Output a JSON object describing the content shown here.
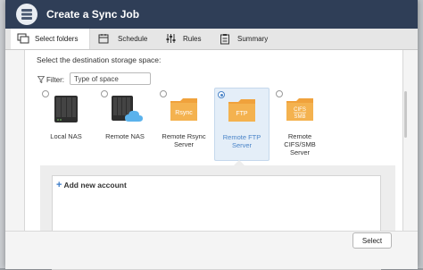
{
  "dialog": {
    "title": "Create a Sync Job"
  },
  "steps": [
    {
      "label": "Select folders",
      "icon": "folders-icon",
      "active": true
    },
    {
      "label": "Schedule",
      "icon": "calendar-icon",
      "active": false
    },
    {
      "label": "Rules",
      "icon": "sliders-icon",
      "active": false
    },
    {
      "label": "Summary",
      "icon": "clipboard-icon",
      "active": false
    }
  ],
  "prompt": "Select the destination storage space:",
  "filter": {
    "label": "Filter:",
    "value": "Type of space"
  },
  "options": [
    {
      "label": "Local NAS",
      "icon": "nas-device-icon",
      "selected": false
    },
    {
      "label": "Remote NAS",
      "icon": "nas-cloud-icon",
      "selected": false
    },
    {
      "label": "Remote Rsync\nServer",
      "icon": "rsync-folder-icon",
      "icon_text": "Rsync",
      "selected": false
    },
    {
      "label": "Remote FTP\nServer",
      "icon": "ftp-folder-icon",
      "icon_text": "FTP",
      "selected": true
    },
    {
      "label": "Remote\nCIFS/SMB\nServer",
      "icon": "cifs-smb-folder-icon",
      "icon_text": "CIFS\nSMB",
      "selected": false
    }
  ],
  "accounts": {
    "add_label": "Add new account"
  },
  "footer": {
    "select_label": "Select"
  },
  "colors": {
    "titlebar": "#2f3e57",
    "accent": "#4a84c8",
    "folder": "#f0a23c"
  }
}
